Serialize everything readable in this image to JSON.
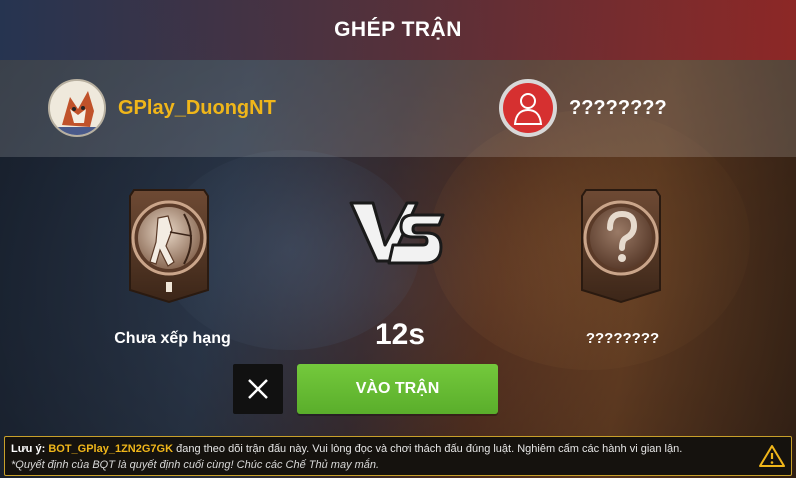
{
  "header": {
    "title": "GHÉP TRẬN"
  },
  "player_left": {
    "name": "GPlay_DuongNT",
    "rank_label": "Chưa xếp hạng",
    "rank_badge_numeral": "I"
  },
  "player_right": {
    "name": "????????",
    "rank_label": "????????"
  },
  "vs_text": "VS",
  "timer": "12s",
  "buttons": {
    "cancel_icon": "close-icon",
    "enter_label": "VÀO TRẬN"
  },
  "notice": {
    "label": "Lưu ý:",
    "bot_name": "BOT_GPlay_1ZN2G7GK",
    "line1_rest": " đang theo dõi trận đấu này. Vui lòng đọc và chơi thách đấu đúng luật. Nghiêm cấm các hành vi gian lận.",
    "line2": "*Quyết định của BQT là quyết định cuối cùng! Chúc các Chế Thủ may mắn."
  },
  "colors": {
    "accent_gold": "#f0b61a",
    "button_green": "#5aae2b",
    "unknown_avatar_red": "#d63030",
    "notice_border": "#c8a02a"
  }
}
